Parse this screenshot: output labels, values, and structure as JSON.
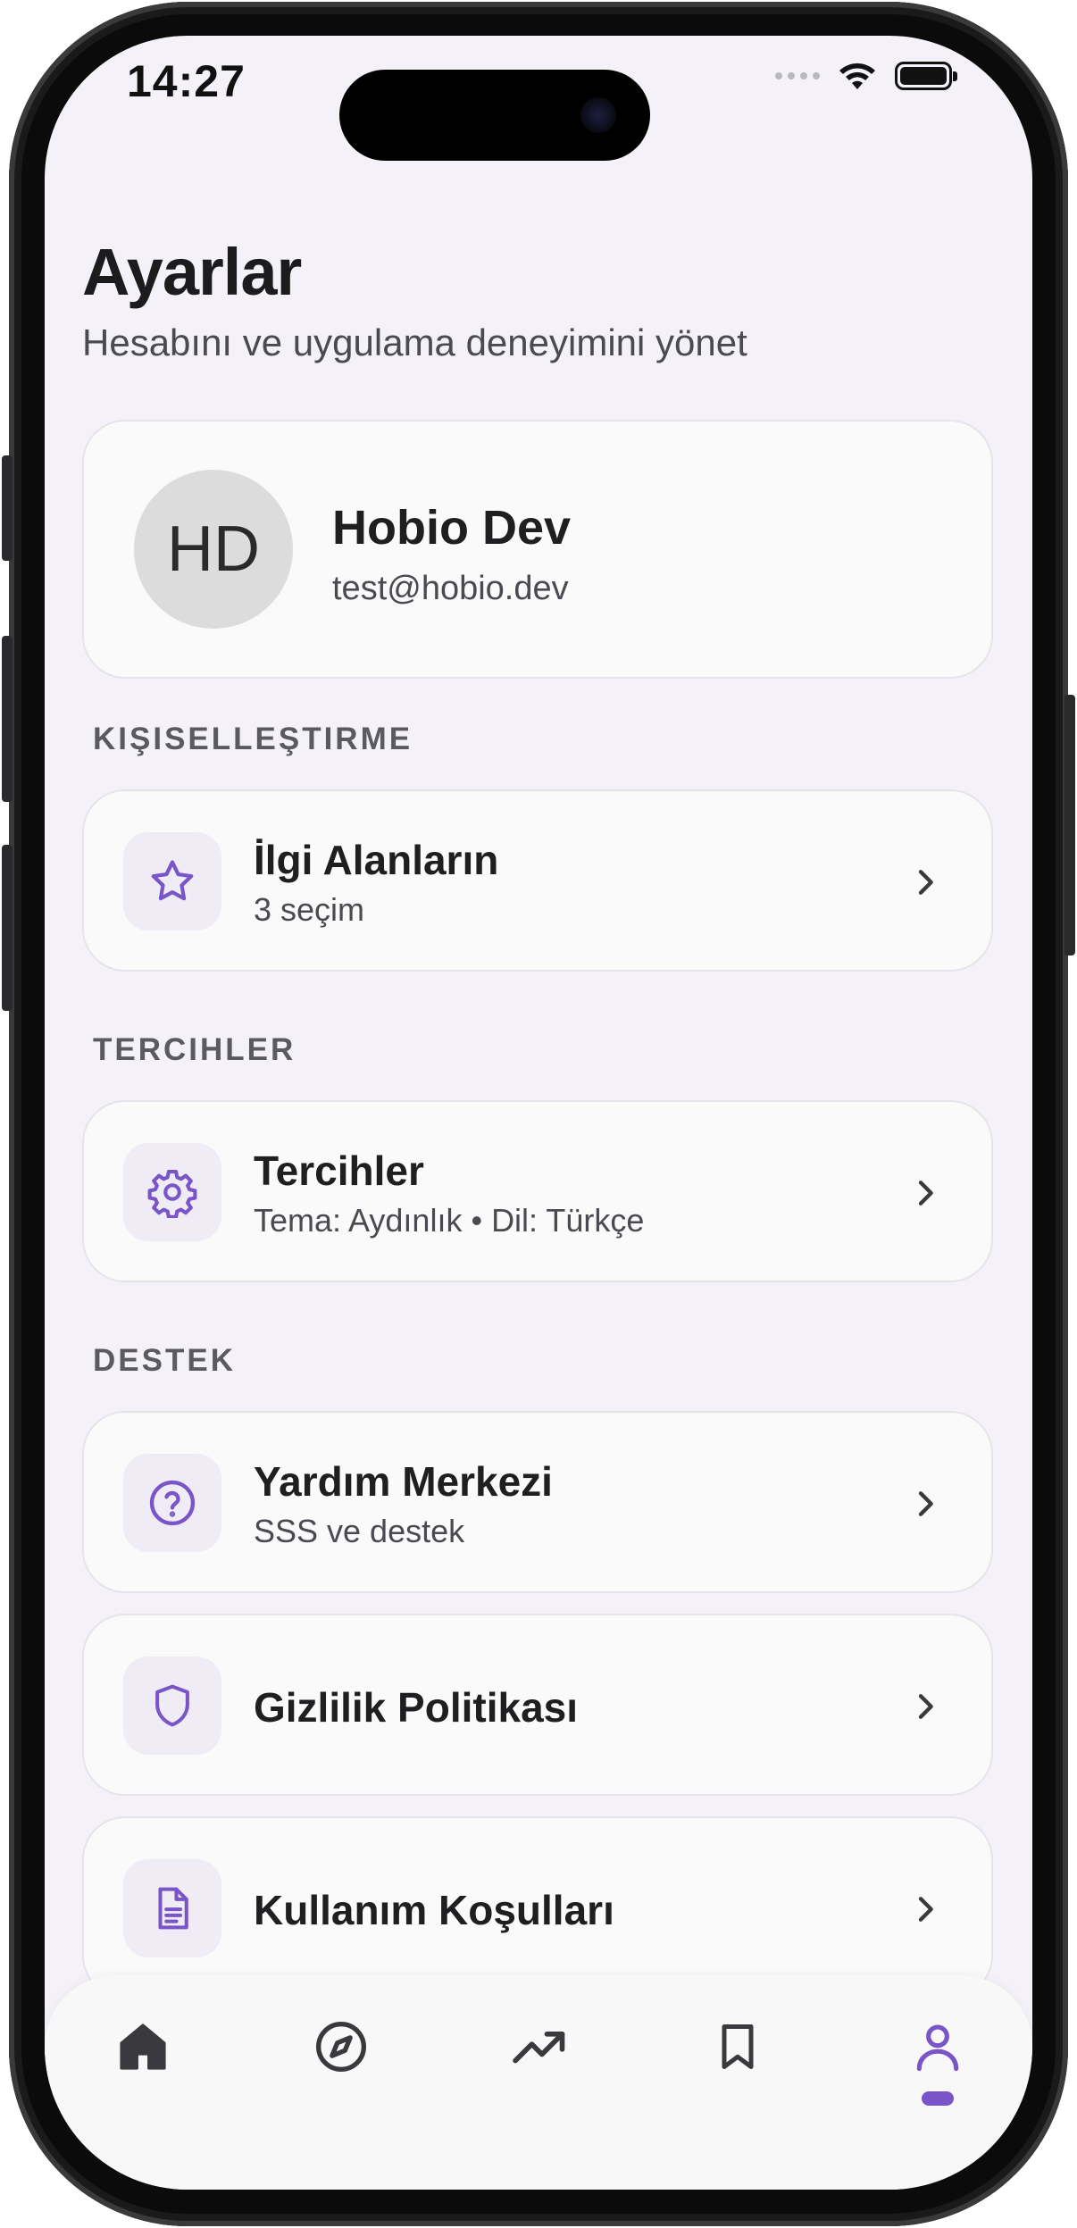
{
  "status_bar": {
    "time": "14:27"
  },
  "header": {
    "title": "Ayarlar",
    "subtitle": "Hesabını ve uygulama deneyimini yönet"
  },
  "profile": {
    "initials": "HD",
    "name": "Hobio Dev",
    "email": "test@hobio.dev"
  },
  "sections": {
    "personalization": {
      "label": "KIŞISELLEŞTIRME",
      "items": [
        {
          "icon": "star-icon",
          "title": "İlgi Alanların",
          "subtitle": "3 seçim"
        }
      ]
    },
    "preferences": {
      "label": "TERCIHLER",
      "items": [
        {
          "icon": "gear-icon",
          "title": "Tercihler",
          "subtitle": "Tema: Aydınlık • Dil: Türkçe"
        }
      ]
    },
    "support": {
      "label": "DESTEK",
      "items": [
        {
          "icon": "question-circle-icon",
          "title": "Yardım Merkezi",
          "subtitle": "SSS ve destek"
        },
        {
          "icon": "shield-icon",
          "title": "Gizlilik Politikası"
        },
        {
          "icon": "document-icon",
          "title": "Kullanım Koşulları"
        }
      ]
    }
  },
  "tabbar": {
    "tabs": [
      {
        "icon": "home-icon",
        "active": false
      },
      {
        "icon": "compass-icon",
        "active": false
      },
      {
        "icon": "trending-icon",
        "active": false
      },
      {
        "icon": "bookmark-icon",
        "active": false
      },
      {
        "icon": "profile-icon",
        "active": true
      }
    ]
  },
  "colors": {
    "accent": "#7a55c8",
    "icon_bg": "#efecf6",
    "background": "#f4f2f8",
    "card": "#fafafb"
  }
}
